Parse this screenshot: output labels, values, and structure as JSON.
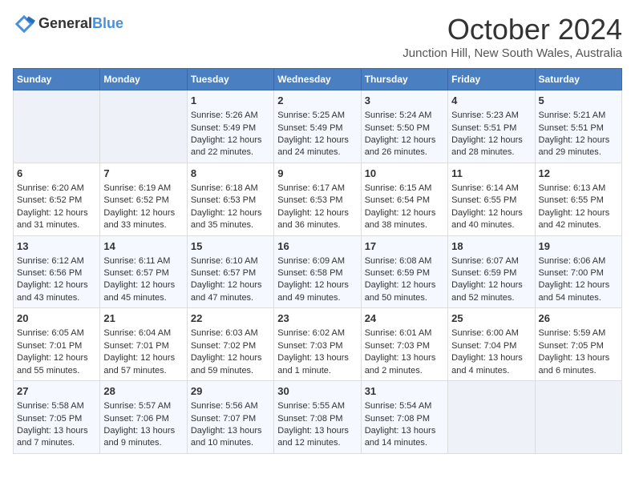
{
  "logo": {
    "text_general": "General",
    "text_blue": "Blue"
  },
  "header": {
    "month": "October 2024",
    "location": "Junction Hill, New South Wales, Australia"
  },
  "days_of_week": [
    "Sunday",
    "Monday",
    "Tuesday",
    "Wednesday",
    "Thursday",
    "Friday",
    "Saturday"
  ],
  "weeks": [
    [
      {
        "day": "",
        "sunrise": "",
        "sunset": "",
        "daylight": ""
      },
      {
        "day": "",
        "sunrise": "",
        "sunset": "",
        "daylight": ""
      },
      {
        "day": "1",
        "sunrise": "Sunrise: 5:26 AM",
        "sunset": "Sunset: 5:49 PM",
        "daylight": "Daylight: 12 hours and 22 minutes."
      },
      {
        "day": "2",
        "sunrise": "Sunrise: 5:25 AM",
        "sunset": "Sunset: 5:49 PM",
        "daylight": "Daylight: 12 hours and 24 minutes."
      },
      {
        "day": "3",
        "sunrise": "Sunrise: 5:24 AM",
        "sunset": "Sunset: 5:50 PM",
        "daylight": "Daylight: 12 hours and 26 minutes."
      },
      {
        "day": "4",
        "sunrise": "Sunrise: 5:23 AM",
        "sunset": "Sunset: 5:51 PM",
        "daylight": "Daylight: 12 hours and 28 minutes."
      },
      {
        "day": "5",
        "sunrise": "Sunrise: 5:21 AM",
        "sunset": "Sunset: 5:51 PM",
        "daylight": "Daylight: 12 hours and 29 minutes."
      }
    ],
    [
      {
        "day": "6",
        "sunrise": "Sunrise: 6:20 AM",
        "sunset": "Sunset: 6:52 PM",
        "daylight": "Daylight: 12 hours and 31 minutes."
      },
      {
        "day": "7",
        "sunrise": "Sunrise: 6:19 AM",
        "sunset": "Sunset: 6:52 PM",
        "daylight": "Daylight: 12 hours and 33 minutes."
      },
      {
        "day": "8",
        "sunrise": "Sunrise: 6:18 AM",
        "sunset": "Sunset: 6:53 PM",
        "daylight": "Daylight: 12 hours and 35 minutes."
      },
      {
        "day": "9",
        "sunrise": "Sunrise: 6:17 AM",
        "sunset": "Sunset: 6:53 PM",
        "daylight": "Daylight: 12 hours and 36 minutes."
      },
      {
        "day": "10",
        "sunrise": "Sunrise: 6:15 AM",
        "sunset": "Sunset: 6:54 PM",
        "daylight": "Daylight: 12 hours and 38 minutes."
      },
      {
        "day": "11",
        "sunrise": "Sunrise: 6:14 AM",
        "sunset": "Sunset: 6:55 PM",
        "daylight": "Daylight: 12 hours and 40 minutes."
      },
      {
        "day": "12",
        "sunrise": "Sunrise: 6:13 AM",
        "sunset": "Sunset: 6:55 PM",
        "daylight": "Daylight: 12 hours and 42 minutes."
      }
    ],
    [
      {
        "day": "13",
        "sunrise": "Sunrise: 6:12 AM",
        "sunset": "Sunset: 6:56 PM",
        "daylight": "Daylight: 12 hours and 43 minutes."
      },
      {
        "day": "14",
        "sunrise": "Sunrise: 6:11 AM",
        "sunset": "Sunset: 6:57 PM",
        "daylight": "Daylight: 12 hours and 45 minutes."
      },
      {
        "day": "15",
        "sunrise": "Sunrise: 6:10 AM",
        "sunset": "Sunset: 6:57 PM",
        "daylight": "Daylight: 12 hours and 47 minutes."
      },
      {
        "day": "16",
        "sunrise": "Sunrise: 6:09 AM",
        "sunset": "Sunset: 6:58 PM",
        "daylight": "Daylight: 12 hours and 49 minutes."
      },
      {
        "day": "17",
        "sunrise": "Sunrise: 6:08 AM",
        "sunset": "Sunset: 6:59 PM",
        "daylight": "Daylight: 12 hours and 50 minutes."
      },
      {
        "day": "18",
        "sunrise": "Sunrise: 6:07 AM",
        "sunset": "Sunset: 6:59 PM",
        "daylight": "Daylight: 12 hours and 52 minutes."
      },
      {
        "day": "19",
        "sunrise": "Sunrise: 6:06 AM",
        "sunset": "Sunset: 7:00 PM",
        "daylight": "Daylight: 12 hours and 54 minutes."
      }
    ],
    [
      {
        "day": "20",
        "sunrise": "Sunrise: 6:05 AM",
        "sunset": "Sunset: 7:01 PM",
        "daylight": "Daylight: 12 hours and 55 minutes."
      },
      {
        "day": "21",
        "sunrise": "Sunrise: 6:04 AM",
        "sunset": "Sunset: 7:01 PM",
        "daylight": "Daylight: 12 hours and 57 minutes."
      },
      {
        "day": "22",
        "sunrise": "Sunrise: 6:03 AM",
        "sunset": "Sunset: 7:02 PM",
        "daylight": "Daylight: 12 hours and 59 minutes."
      },
      {
        "day": "23",
        "sunrise": "Sunrise: 6:02 AM",
        "sunset": "Sunset: 7:03 PM",
        "daylight": "Daylight: 13 hours and 1 minute."
      },
      {
        "day": "24",
        "sunrise": "Sunrise: 6:01 AM",
        "sunset": "Sunset: 7:03 PM",
        "daylight": "Daylight: 13 hours and 2 minutes."
      },
      {
        "day": "25",
        "sunrise": "Sunrise: 6:00 AM",
        "sunset": "Sunset: 7:04 PM",
        "daylight": "Daylight: 13 hours and 4 minutes."
      },
      {
        "day": "26",
        "sunrise": "Sunrise: 5:59 AM",
        "sunset": "Sunset: 7:05 PM",
        "daylight": "Daylight: 13 hours and 6 minutes."
      }
    ],
    [
      {
        "day": "27",
        "sunrise": "Sunrise: 5:58 AM",
        "sunset": "Sunset: 7:05 PM",
        "daylight": "Daylight: 13 hours and 7 minutes."
      },
      {
        "day": "28",
        "sunrise": "Sunrise: 5:57 AM",
        "sunset": "Sunset: 7:06 PM",
        "daylight": "Daylight: 13 hours and 9 minutes."
      },
      {
        "day": "29",
        "sunrise": "Sunrise: 5:56 AM",
        "sunset": "Sunset: 7:07 PM",
        "daylight": "Daylight: 13 hours and 10 minutes."
      },
      {
        "day": "30",
        "sunrise": "Sunrise: 5:55 AM",
        "sunset": "Sunset: 7:08 PM",
        "daylight": "Daylight: 13 hours and 12 minutes."
      },
      {
        "day": "31",
        "sunrise": "Sunrise: 5:54 AM",
        "sunset": "Sunset: 7:08 PM",
        "daylight": "Daylight: 13 hours and 14 minutes."
      },
      {
        "day": "",
        "sunrise": "",
        "sunset": "",
        "daylight": ""
      },
      {
        "day": "",
        "sunrise": "",
        "sunset": "",
        "daylight": ""
      }
    ]
  ]
}
